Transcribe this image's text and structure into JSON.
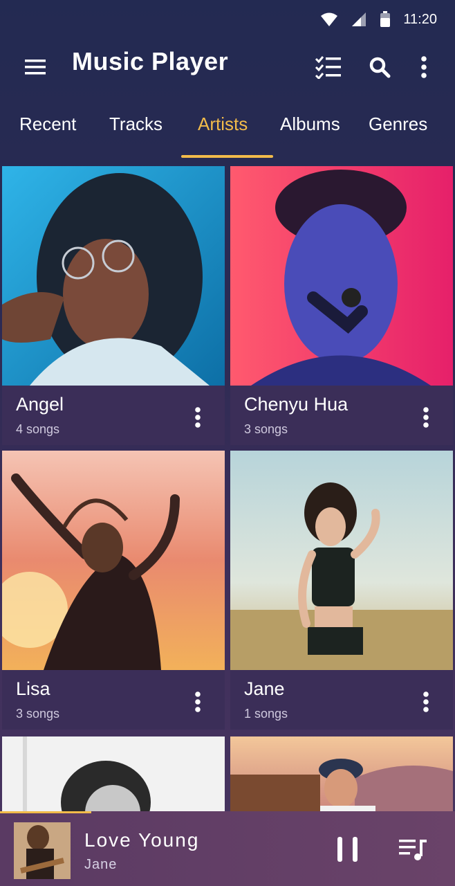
{
  "status": {
    "time": "11:20"
  },
  "app": {
    "title": "Music Player"
  },
  "tabs": [
    {
      "label": "Recent",
      "active": false
    },
    {
      "label": "Tracks",
      "active": false
    },
    {
      "label": "Artists",
      "active": true
    },
    {
      "label": "Albums",
      "active": false
    },
    {
      "label": "Genres",
      "active": false
    }
  ],
  "artists": [
    {
      "name": "Angel",
      "count": "4 songs"
    },
    {
      "name": "Chenyu Hua",
      "count": "3 songs"
    },
    {
      "name": "Lisa",
      "count": "3 songs"
    },
    {
      "name": "Jane",
      "count": "1 songs"
    }
  ],
  "now_playing": {
    "title": "Love Young",
    "artist": "Jane",
    "progress_fraction": 0.2
  },
  "colors": {
    "accent": "#f2bb4a",
    "background_top": "#232a52",
    "background_bottom": "#4a3561"
  },
  "icons": [
    "wifi-icon",
    "signal-icon",
    "battery-icon",
    "menu-icon",
    "checklist-icon",
    "search-icon",
    "more-vert-icon",
    "pause-icon",
    "queue-music-icon"
  ]
}
